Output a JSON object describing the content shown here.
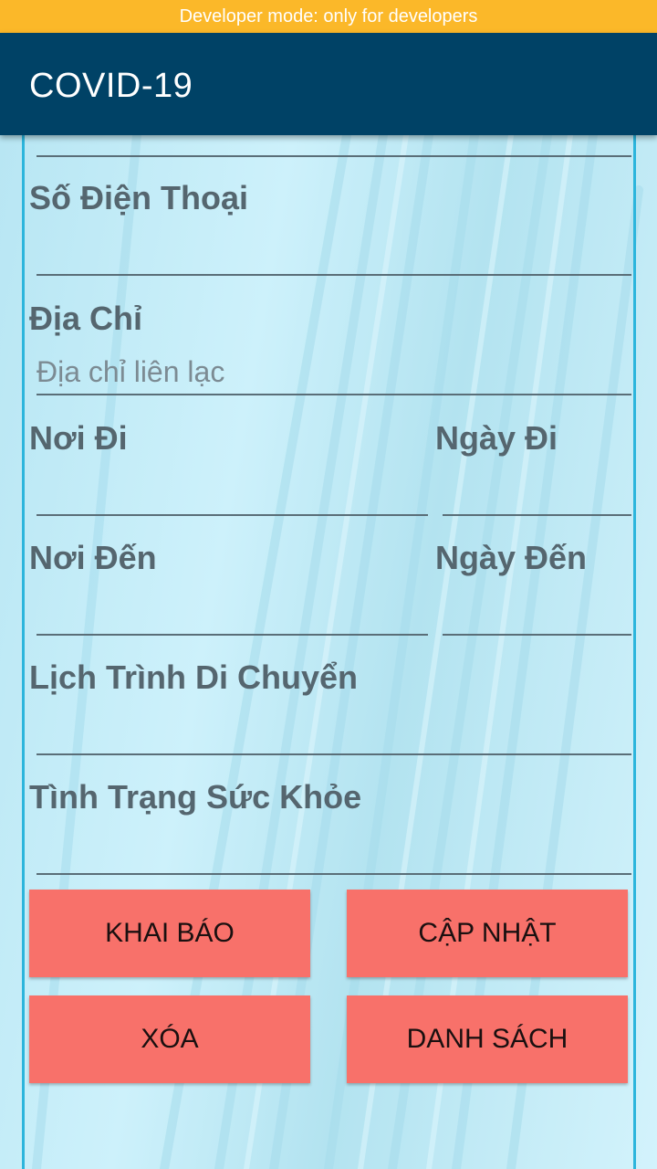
{
  "status_bar": {
    "banner_text": "Developer mode: only for developers"
  },
  "app_bar": {
    "title": "COVID-19"
  },
  "form": {
    "phone": {
      "label": "Số Điện Thoại",
      "value": ""
    },
    "address": {
      "label": "Địa Chỉ",
      "placeholder": "Địa chỉ liên lạc",
      "value": ""
    },
    "from_place": {
      "label": "Nơi Đi",
      "value": ""
    },
    "from_date": {
      "label": "Ngày Đi",
      "value": ""
    },
    "to_place": {
      "label": "Nơi Đến",
      "value": ""
    },
    "to_date": {
      "label": "Ngày Đến",
      "value": ""
    },
    "itinerary": {
      "label": "Lịch Trình Di Chuyển",
      "value": ""
    },
    "health": {
      "label": "Tình Trạng Sức Khỏe",
      "value": ""
    }
  },
  "buttons": {
    "declare": "KHAI BÁO",
    "update": "CẬP NHẬT",
    "delete": "XÓA",
    "list": "DANH SÁCH"
  },
  "colors": {
    "banner": "#fbb829",
    "app_bar": "#004266",
    "button": "#f8716a",
    "frame": "#2cb5dc"
  }
}
